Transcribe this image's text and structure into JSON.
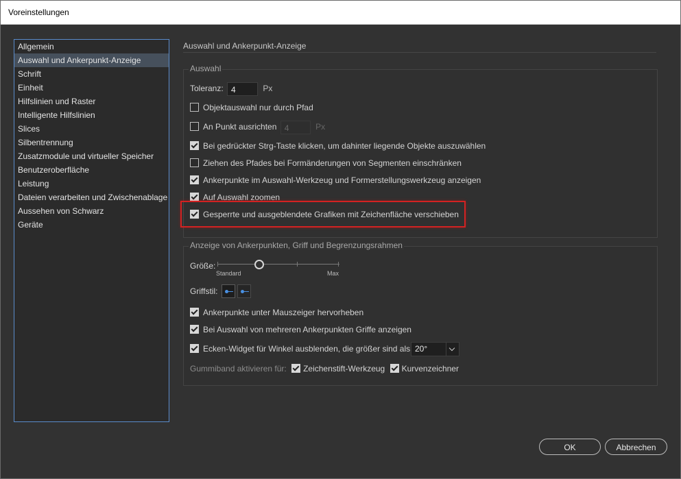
{
  "window": {
    "title": "Voreinstellungen"
  },
  "sidebar": {
    "items": [
      {
        "label": "Allgemein"
      },
      {
        "label": "Auswahl und Ankerpunkt-Anzeige"
      },
      {
        "label": "Schrift"
      },
      {
        "label": "Einheit"
      },
      {
        "label": "Hilfslinien und Raster"
      },
      {
        "label": "Intelligente Hilfslinien"
      },
      {
        "label": "Slices"
      },
      {
        "label": "Silbentrennung"
      },
      {
        "label": "Zusatzmodule und virtueller Speicher"
      },
      {
        "label": "Benutzeroberfläche"
      },
      {
        "label": "Leistung"
      },
      {
        "label": "Dateien verarbeiten und Zwischenablage"
      },
      {
        "label": "Aussehen von Schwarz"
      },
      {
        "label": "Geräte"
      }
    ],
    "selected": "Auswahl und Ankerpunkt-Anzeige"
  },
  "main": {
    "section_title": "Auswahl und Ankerpunkt-Anzeige",
    "selection": {
      "label": "Auswahl",
      "tolerance": {
        "label": "Toleranz:",
        "value": "4",
        "unit": "Px"
      },
      "options": [
        {
          "label": "Objektauswahl nur durch Pfad",
          "checked": false
        },
        {
          "label": "An Punkt ausrichten",
          "checked": false,
          "value": "4",
          "unit": "Px"
        },
        {
          "label": "Bei gedrückter Strg-Taste klicken, um dahinter liegende Objekte auszuwählen",
          "checked": true
        },
        {
          "label": "Ziehen des Pfades bei Formänderungen von Segmenten einschränken",
          "checked": false
        },
        {
          "label": "Ankerpunkte im Auswahl-Werkzeug und Formerstellungswerkzeug anzeigen",
          "checked": true
        },
        {
          "label": "Auf Auswahl zoomen",
          "checked": true
        },
        {
          "label": "Gesperrte und ausgeblendete Grafiken mit Zeichenfläche verschieben",
          "checked": true
        }
      ]
    },
    "anchor_display": {
      "label": "Anzeige von Ankerpunkten, Griff und Begrenzungsrahmen",
      "size": {
        "label": "Größe:",
        "min_label": "Standard",
        "max_label": "Max",
        "level_fraction": 0.33
      },
      "handle_style": {
        "label": "Griffstil:"
      },
      "options": [
        {
          "label": "Ankerpunkte unter Mauszeiger hervorheben",
          "checked": true
        },
        {
          "label": "Bei Auswahl von mehreren Ankerpunkten Griffe anzeigen",
          "checked": true
        },
        {
          "label": "Ecken-Widget für Winkel ausblenden, die größer sind als:",
          "checked": true,
          "value": "20°"
        }
      ],
      "rubber_band": {
        "label": "Gummiband aktivieren für:",
        "pen_label": "Zeichenstift-Werkzeug",
        "pen_checked": true,
        "curvature_label": "Kurvenzeichner",
        "curvature_checked": true
      }
    }
  },
  "footer": {
    "ok_label": "OK",
    "cancel_label": "Abbrechen"
  },
  "colors": {
    "accent": "#4a90e2",
    "highlight": "#d32222",
    "background": "#323232"
  }
}
